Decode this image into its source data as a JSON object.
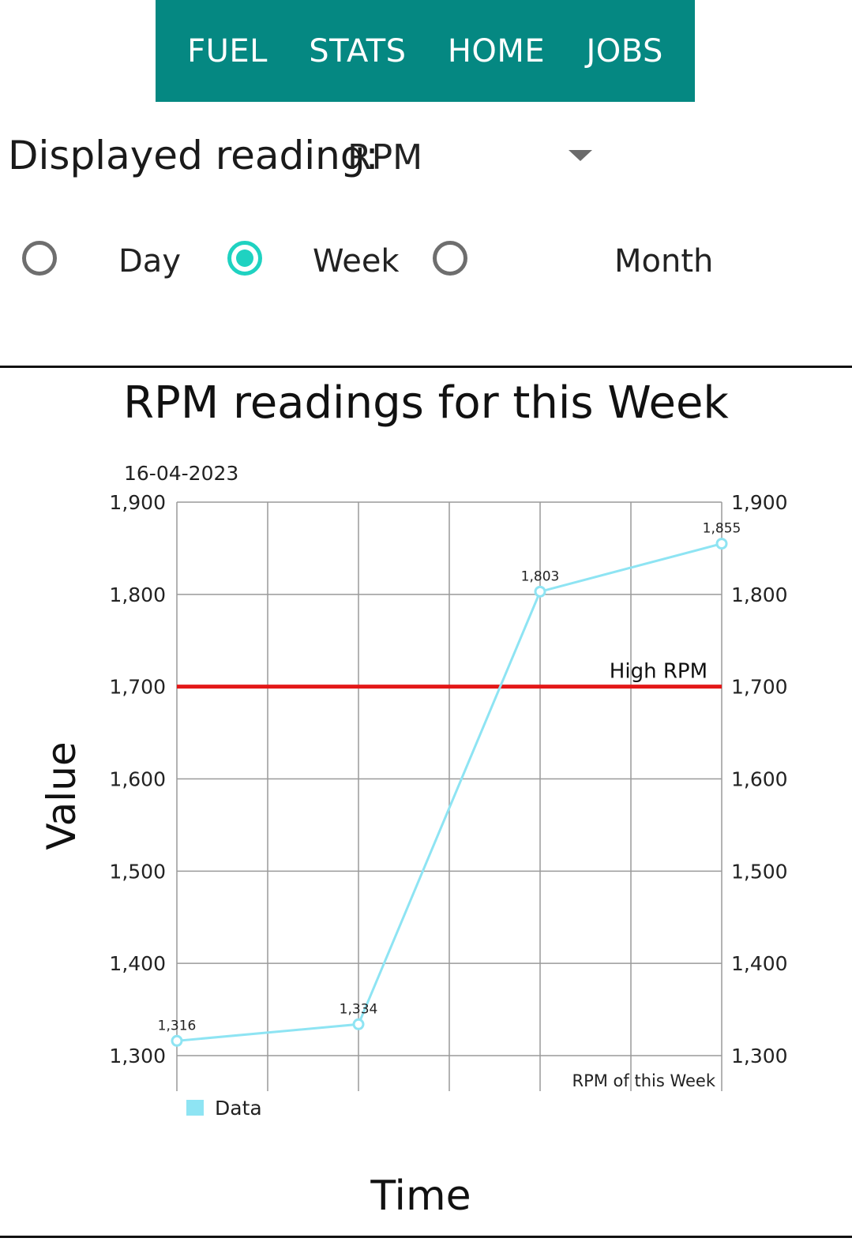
{
  "tabs": [
    {
      "label": "FUEL"
    },
    {
      "label": "STATS"
    },
    {
      "label": "HOME"
    },
    {
      "label": "JOBS"
    }
  ],
  "colors": {
    "tab_bar": "#058882",
    "radio_selected": "#1fd2c1",
    "series": "#8ee4f3",
    "threshold": "#e31818"
  },
  "reading": {
    "label": "Displayed reading:",
    "value": "RPM"
  },
  "period": {
    "options": [
      {
        "label": "Day",
        "selected": false
      },
      {
        "label": "Week",
        "selected": true
      },
      {
        "label": "Month",
        "selected": false
      }
    ]
  },
  "chart_data": {
    "type": "line",
    "title": "RPM readings for this Week",
    "date_label": "16-04-2023",
    "xlabel": "Time",
    "ylabel": "Value",
    "ylim": [
      1300,
      1900
    ],
    "yticks": [
      "1,900",
      "1,800",
      "1,700",
      "1,600",
      "1,500",
      "1,400",
      "1,300"
    ],
    "x_grid_count": 6,
    "series": [
      {
        "name": "Data",
        "points": [
          {
            "x": 0,
            "y": 1316,
            "label": "1,316"
          },
          {
            "x": 2,
            "y": 1334,
            "label": "1,334"
          },
          {
            "x": 4,
            "y": 1803,
            "label": "1,803"
          },
          {
            "x": 6,
            "y": 1855,
            "label": "1,855"
          }
        ]
      }
    ],
    "threshold": {
      "value": 1700,
      "label": "High RPM"
    },
    "description": "RPM of this Week",
    "grid": true,
    "legend": "bottom-left"
  }
}
